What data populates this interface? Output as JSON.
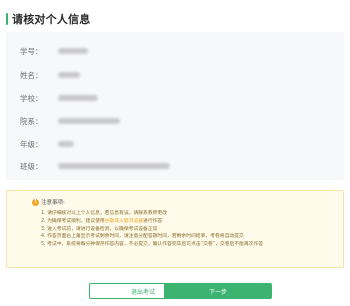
{
  "header": {
    "title": "请核对个人信息"
  },
  "info": {
    "fields": [
      {
        "label": "学号："
      },
      {
        "label": "姓名："
      },
      {
        "label": "学校："
      },
      {
        "label": "院系："
      },
      {
        "label": "年级："
      },
      {
        "label": "班级："
      }
    ]
  },
  "notice": {
    "icon": "warning-icon",
    "title": "注意事项:",
    "items": [
      "1. 请仔细核对以上个人信息，若信息有误，请联系教师更改",
      "2. 为确保考试顺利，建议使用",
      "3. 进入考试前，请进行设备检测，以确保考试设备正常",
      "4. 作答页面右上角显示考试剩余时间，请注意分配答题时间，若剩余时间结束，考卷将自动提交",
      "5. 考试中，系统将每分钟保存作答内容，不必提交，确认作答完毕后可点击“交卷”，交卷后不能再次作答"
    ],
    "item2_highlight": "谷歌或火狐浏览器",
    "item2_suffix": "进行作答"
  },
  "buttons": {
    "exit_label": "退出考试",
    "next_label": "下一步"
  },
  "colors": {
    "accent": "#3cb371",
    "warning": "#f5a623"
  }
}
